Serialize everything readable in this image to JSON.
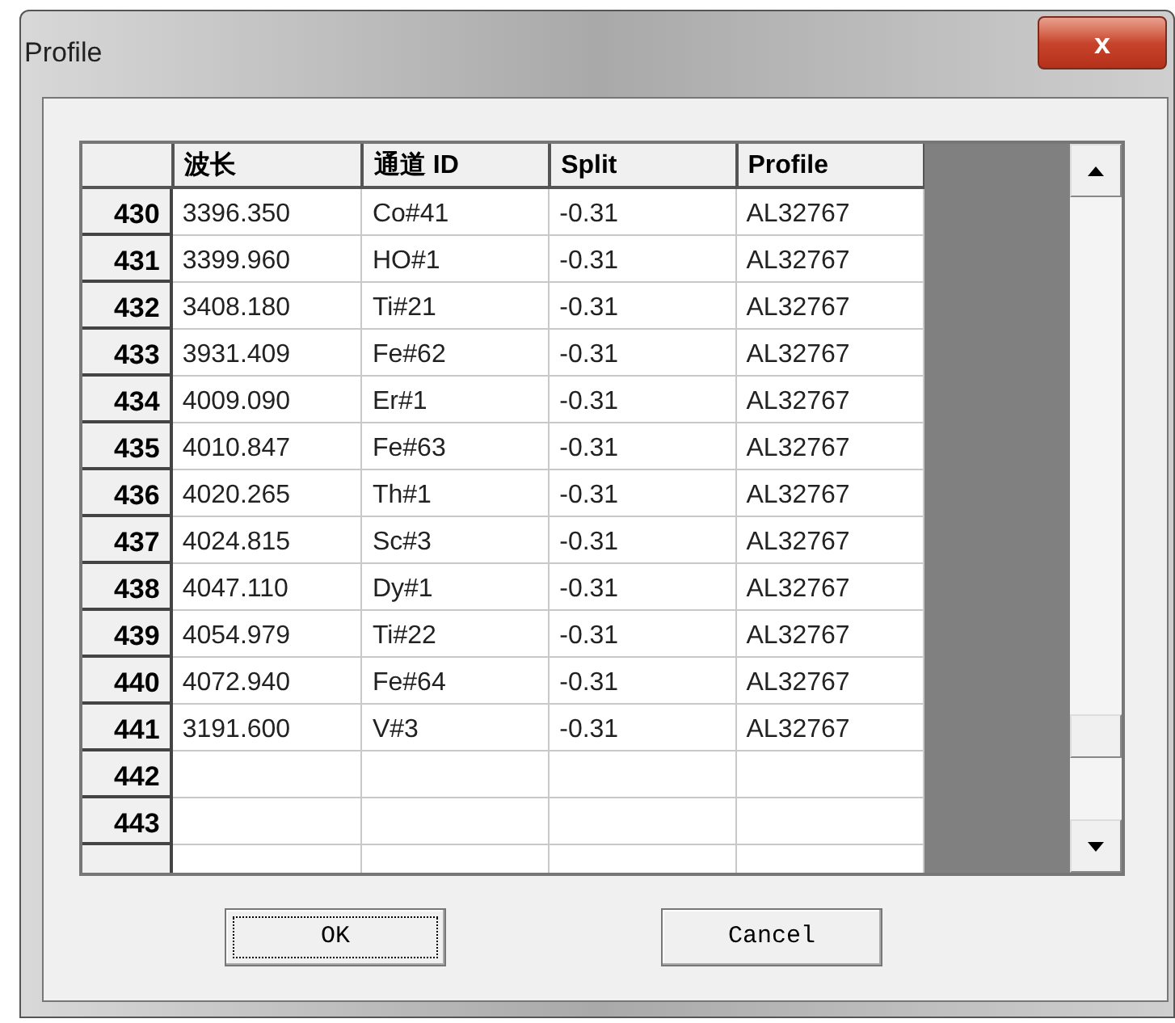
{
  "window": {
    "title": "Profile",
    "close_label": "x"
  },
  "table": {
    "columns": [
      "波长",
      "通道 ID",
      "Split",
      "Profile"
    ],
    "rows": [
      {
        "header": "430",
        "cells": [
          "3396.350",
          "Co#41",
          "-0.31",
          "AL32767"
        ]
      },
      {
        "header": "431",
        "cells": [
          "3399.960",
          "HO#1",
          "-0.31",
          "AL32767"
        ]
      },
      {
        "header": "432",
        "cells": [
          "3408.180",
          "Ti#21",
          "-0.31",
          "AL32767"
        ]
      },
      {
        "header": "433",
        "cells": [
          "3931.409",
          "Fe#62",
          "-0.31",
          "AL32767"
        ]
      },
      {
        "header": "434",
        "cells": [
          "4009.090",
          "Er#1",
          "-0.31",
          "AL32767"
        ]
      },
      {
        "header": "435",
        "cells": [
          "4010.847",
          "Fe#63",
          "-0.31",
          "AL32767"
        ]
      },
      {
        "header": "436",
        "cells": [
          "4020.265",
          "Th#1",
          "-0.31",
          "AL32767"
        ]
      },
      {
        "header": "437",
        "cells": [
          "4024.815",
          "Sc#3",
          "-0.31",
          "AL32767"
        ]
      },
      {
        "header": "438",
        "cells": [
          "4047.110",
          "Dy#1",
          "-0.31",
          "AL32767"
        ]
      },
      {
        "header": "439",
        "cells": [
          "4054.979",
          "Ti#22",
          "-0.31",
          "AL32767"
        ]
      },
      {
        "header": "440",
        "cells": [
          "4072.940",
          "Fe#64",
          "-0.31",
          "AL32767"
        ]
      },
      {
        "header": "441",
        "cells": [
          "3191.600",
          "V#3",
          "-0.31",
          "AL32767"
        ]
      },
      {
        "header": "442",
        "cells": []
      },
      {
        "header": "443",
        "cells": []
      }
    ]
  },
  "buttons": [
    {
      "label": "OK",
      "focused": true
    },
    {
      "label": "Cancel",
      "focused": false
    }
  ]
}
